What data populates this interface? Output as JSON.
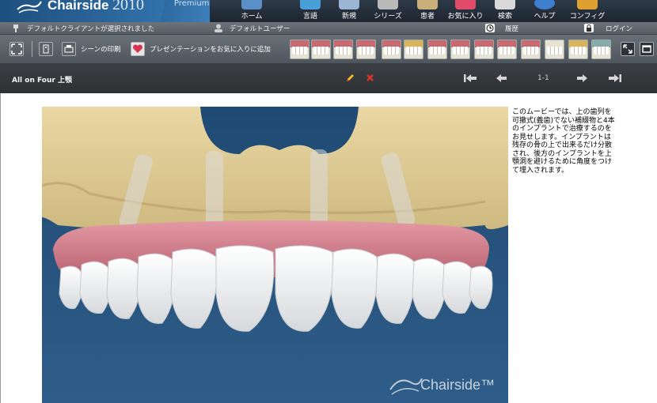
{
  "header": {
    "brand_name": "Chairside",
    "brand_year": "2010",
    "edition": "Premium",
    "nav": [
      {
        "label": "ホーム",
        "icon": "home-icon",
        "color": "#5b8fc7"
      },
      {
        "label": "言語",
        "icon": "language-icon",
        "color": "#4a9fd8"
      },
      {
        "label": "新規",
        "icon": "new-icon",
        "color": "#9ab6d4"
      },
      {
        "label": "シリーズ",
        "icon": "series-icon",
        "color": "#b9b9b9"
      },
      {
        "label": "患者",
        "icon": "patient-icon",
        "color": "#c9b07a"
      },
      {
        "label": "お気に入り",
        "icon": "favorites-icon",
        "color": "#e04b6a"
      },
      {
        "label": "検索",
        "icon": "search-icon",
        "color": "#d9d9d9"
      },
      {
        "label": "ヘルプ",
        "icon": "help-icon",
        "color": "#3f7fd0"
      },
      {
        "label": "コンフィグ",
        "icon": "config-icon",
        "color": "#e0a030"
      }
    ]
  },
  "status": {
    "client": "デフォルトクライアントが選択されました",
    "user": "デフォルトユーザー",
    "history": "履歴",
    "login": "ログイン"
  },
  "toolbar": {
    "print_label": "シーンの印刷",
    "favorite_label": "プレゼンテーションをお気に入りに追加",
    "thumbnail_count": 17
  },
  "scene": {
    "title": "All on Four 上顎",
    "page": "1-1",
    "description": "このムービーでは、上の歯列を可撤式(義歯)でない補綴物と4本のインプラントで治療するのをお見せします。インプラントは残存の骨の上で出来るだけ分散され、後方のインプラントを上顎洞を避けるために角度をつけて埋入されます。",
    "watermark": "Chairside™"
  }
}
